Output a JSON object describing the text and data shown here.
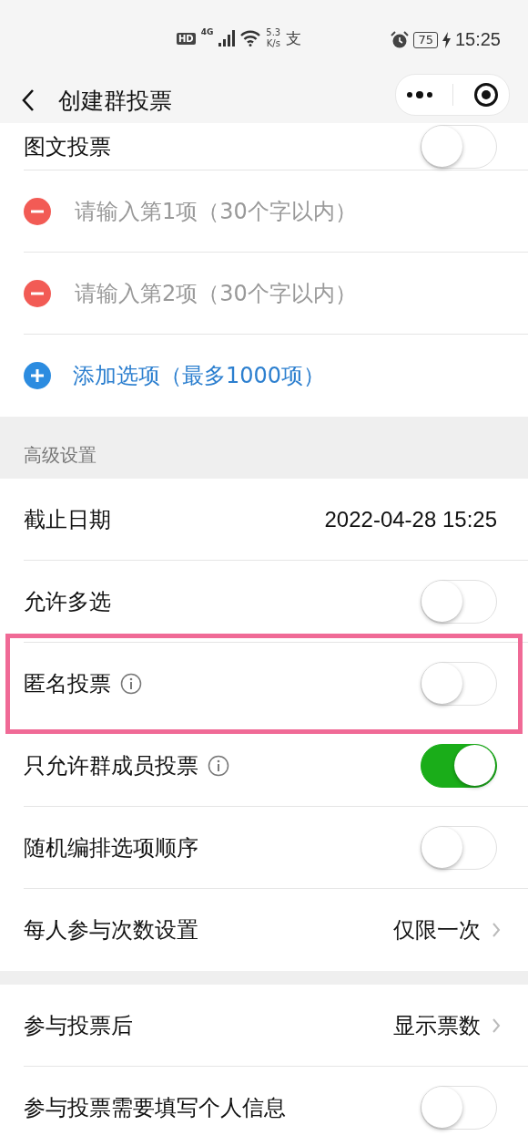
{
  "status_bar": {
    "hd_badge": "HD",
    "network": "4G",
    "speed_value": "5.3",
    "speed_unit": "K/s",
    "app_glyph": "支",
    "battery": "75",
    "time": "15:25"
  },
  "nav": {
    "title": "创建群投票"
  },
  "top_row": {
    "label": "图文投票",
    "on": false
  },
  "options": [
    {
      "placeholder": "请输入第1项（30个字以内）"
    },
    {
      "placeholder": "请输入第2项（30个字以内）"
    }
  ],
  "add_option": "添加选项（最多1000项）",
  "section_title": "高级设置",
  "groups": [
    [
      {
        "kind": "value",
        "label": "截止日期",
        "value": "2022-04-28   15:25",
        "info": false,
        "highlighted": false
      },
      {
        "kind": "toggle",
        "label": "允许多选",
        "on": false,
        "info": false,
        "highlighted": false
      },
      {
        "kind": "toggle",
        "label": "匿名投票",
        "on": false,
        "info": true,
        "highlighted": true
      },
      {
        "kind": "toggle",
        "label": "只允许群成员投票",
        "on": true,
        "info": true,
        "highlighted": false
      },
      {
        "kind": "toggle",
        "label": "随机编排选项顺序",
        "on": false,
        "info": false,
        "highlighted": false
      },
      {
        "kind": "select",
        "label": "每人参与次数设置",
        "value": "仅限一次",
        "info": false,
        "highlighted": false
      }
    ],
    [
      {
        "kind": "select",
        "label": "参与投票后",
        "value": "显示票数",
        "info": false,
        "highlighted": false
      },
      {
        "kind": "toggle",
        "label": "参与投票需要填写个人信息",
        "on": false,
        "info": false,
        "highlighted": false
      }
    ]
  ]
}
